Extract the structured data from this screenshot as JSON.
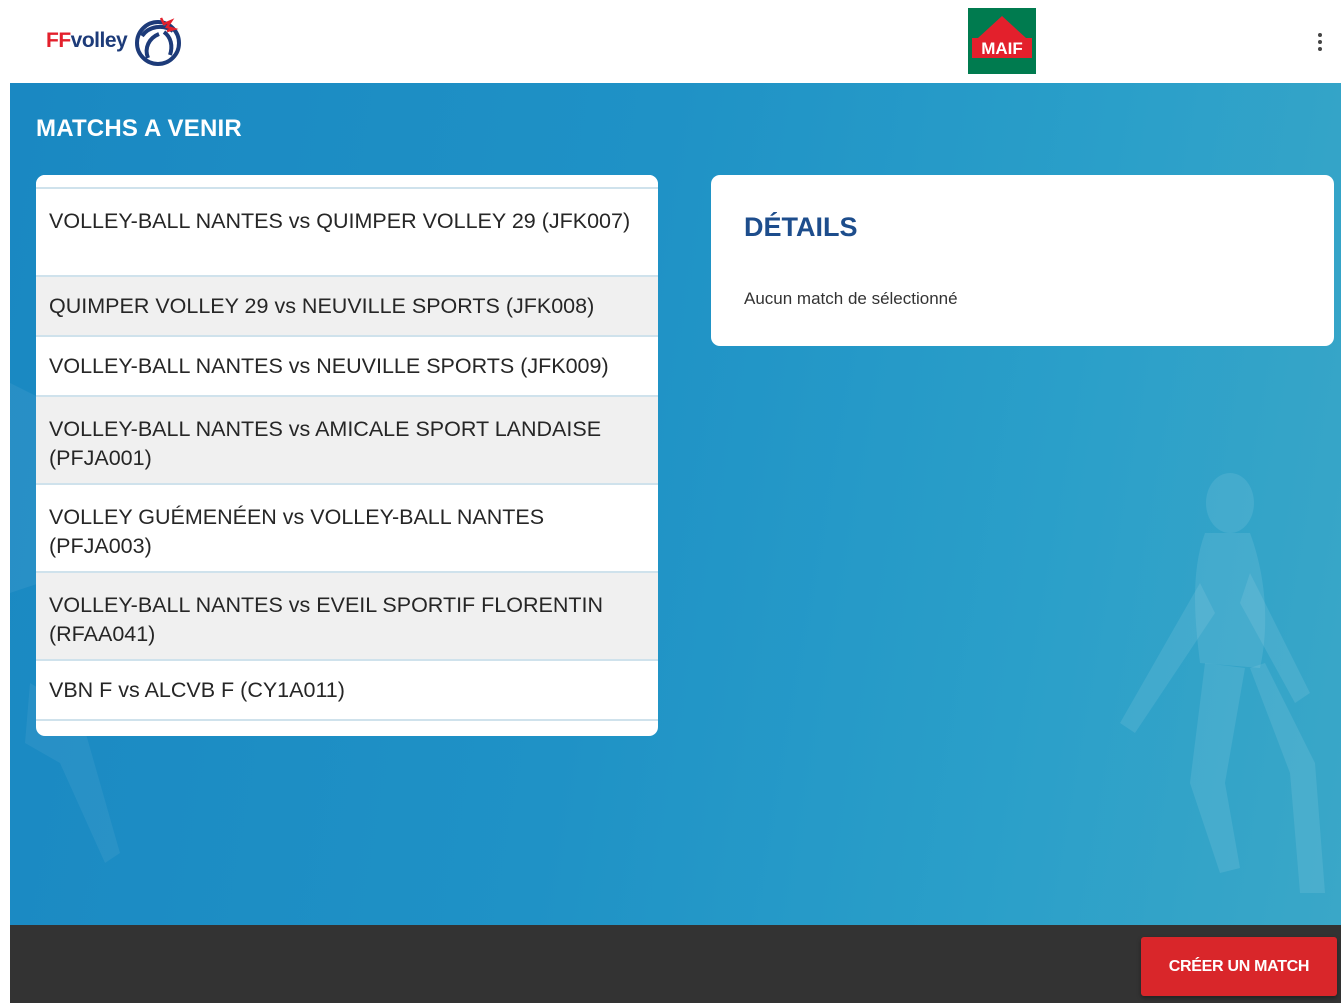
{
  "header": {
    "brand_prefix": "FF",
    "brand_name": "volley",
    "sponsor_text": "MAIF",
    "menu_icon": "more-vertical-icon"
  },
  "section": {
    "title": "MATCHS A VENIR"
  },
  "matches": [
    {
      "label": "VOLLEY-BALL NANTES vs QUIMPER VOLLEY 29 (JFK007)"
    },
    {
      "label": "QUIMPER VOLLEY 29 vs NEUVILLE SPORTS (JFK008)"
    },
    {
      "label": "VOLLEY-BALL NANTES vs NEUVILLE SPORTS (JFK009)"
    },
    {
      "label": "VOLLEY-BALL NANTES vs AMICALE SPORT LANDAISE (PFJA001)"
    },
    {
      "label": "VOLLEY GUÉMENÉEN vs VOLLEY-BALL NANTES (PFJA003)"
    },
    {
      "label": "VOLLEY-BALL NANTES vs EVEIL SPORTIF FLORENTIN (RFAA041)"
    },
    {
      "label": "VBN F vs ALCVB F (CY1A011)"
    }
  ],
  "details": {
    "title": "DÉTAILS",
    "empty_message": "Aucun match de sélectionné"
  },
  "footer": {
    "create_button": "CRÉER UN MATCH"
  },
  "colors": {
    "brand_red": "#e3202c",
    "brand_blue": "#1d3b79",
    "background_blue": "#1f92c6",
    "sponsor_green": "#007b4f",
    "footer": "#333333",
    "button_red": "#d9262a"
  }
}
